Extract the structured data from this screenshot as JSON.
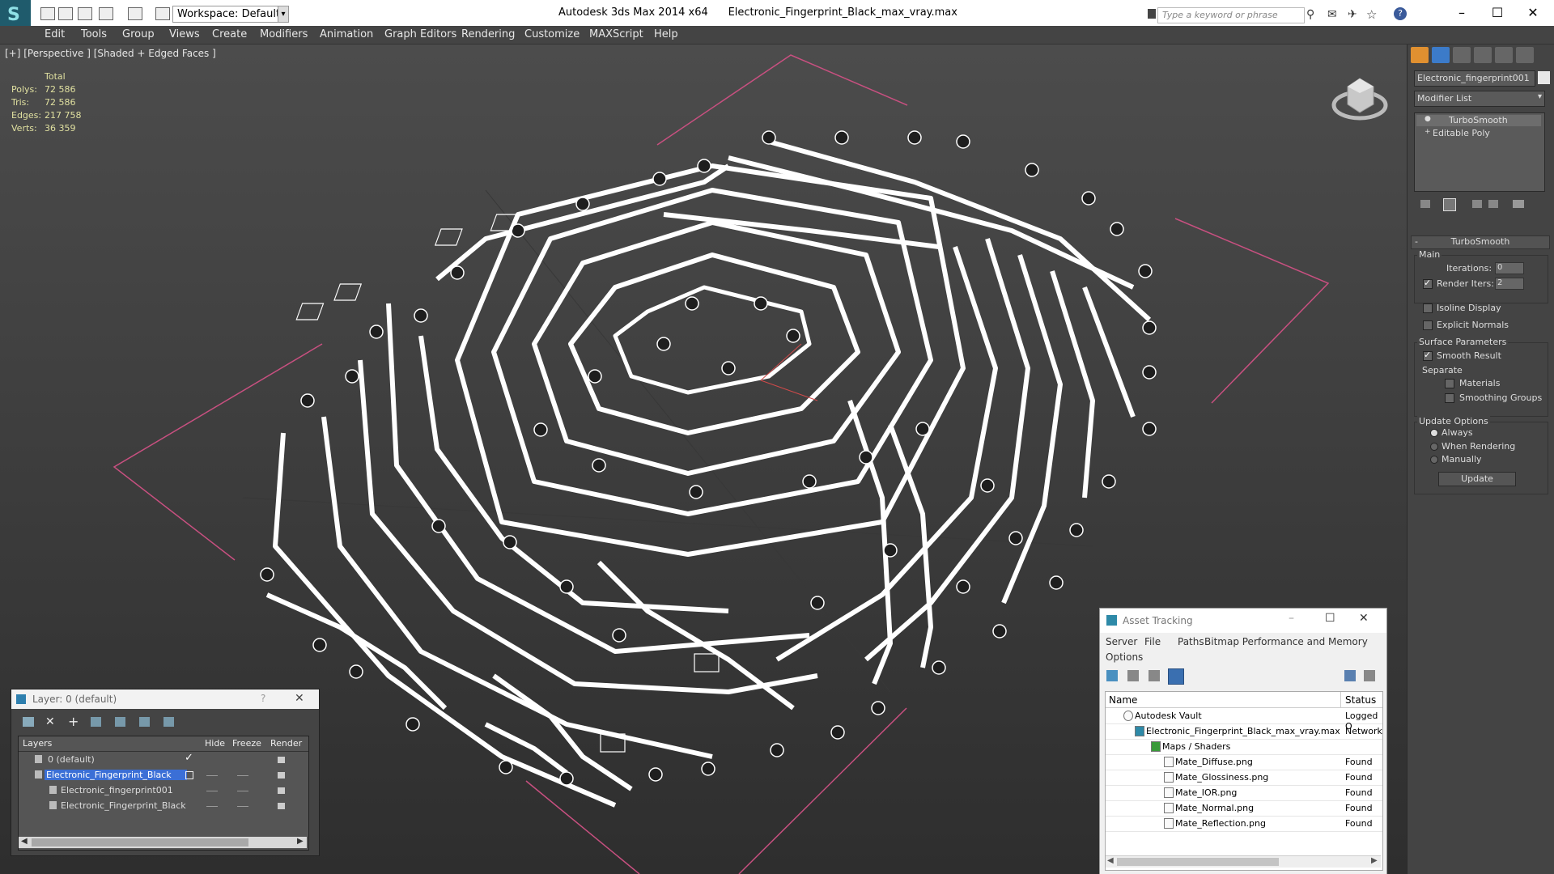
{
  "app": {
    "title": "Autodesk 3ds Max  2014 x64",
    "filename": "Electronic_Fingerprint_Black_max_vray.max",
    "workspace": "Workspace: Default",
    "search_placeholder": "Type a keyword or phrase"
  },
  "menu": [
    "Edit",
    "Tools",
    "Group",
    "Views",
    "Create",
    "Modifiers",
    "Animation",
    "Graph Editors",
    "Rendering",
    "Customize",
    "MAXScript",
    "Help"
  ],
  "viewport": {
    "label": "[+] [Perspective ] [Shaded + Edged Faces ]",
    "stats_header": "Total",
    "stats": [
      {
        "key": "Polys:",
        "value": "72 586"
      },
      {
        "key": "Tris:",
        "value": "72 586"
      },
      {
        "key": "Edges:",
        "value": "217 758"
      },
      {
        "key": "Verts:",
        "value": "36 359"
      }
    ]
  },
  "command_panel": {
    "object_name": "Electronic_fingerprint001",
    "modifier_list": "Modifier List",
    "stack": [
      "TurboSmooth",
      "Editable Poly"
    ],
    "rollout_title": "TurboSmooth",
    "main_label": "Main",
    "iterations_label": "Iterations:",
    "iterations_value": "0",
    "render_iters_label": "Render Iters:",
    "render_iters_value": "2",
    "isoline_label": "Isoline Display",
    "explicit_normals_label": "Explicit Normals",
    "surface_params_label": "Surface Parameters",
    "smooth_result_label": "Smooth Result",
    "separate_label": "Separate",
    "materials_label": "Materials",
    "smoothing_groups_label": "Smoothing Groups",
    "update_options_label": "Update Options",
    "always_label": "Always",
    "when_rendering_label": "When Rendering",
    "manually_label": "Manually",
    "update_button": "Update"
  },
  "layer_dialog": {
    "title": "Layer: 0 (default)",
    "help": "?",
    "columns": [
      "Layers",
      "Hide",
      "Freeze",
      "Render"
    ],
    "rows": [
      {
        "name": "0 (default)"
      },
      {
        "name": "Electronic_Fingerprint_Black"
      },
      {
        "name": "Electronic_fingerprint001"
      },
      {
        "name": "Electronic_Fingerprint_Black"
      }
    ]
  },
  "asset_tracking": {
    "title": "Asset Tracking",
    "menu": [
      "Server",
      "File",
      "Paths",
      "Bitmap Performance and Memory",
      "Options"
    ],
    "columns": [
      "Name",
      "Status"
    ],
    "rows": [
      {
        "name": "Autodesk Vault",
        "status": "Logged O"
      },
      {
        "name": "Electronic_Fingerprint_Black_max_vray.max",
        "status": "Network"
      },
      {
        "name": "Maps / Shaders",
        "status": ""
      },
      {
        "name": "Mate_Diffuse.png",
        "status": "Found"
      },
      {
        "name": "Mate_Glossiness.png",
        "status": "Found"
      },
      {
        "name": "Mate_IOR.png",
        "status": "Found"
      },
      {
        "name": "Mate_Normal.png",
        "status": "Found"
      },
      {
        "name": "Mate_Reflection.png",
        "status": "Found"
      }
    ]
  },
  "colors": {
    "selection": "#3b6fd6",
    "accent": "#1f5b6c",
    "trace": "#ffffff",
    "grid_boundary": "#c85080"
  }
}
